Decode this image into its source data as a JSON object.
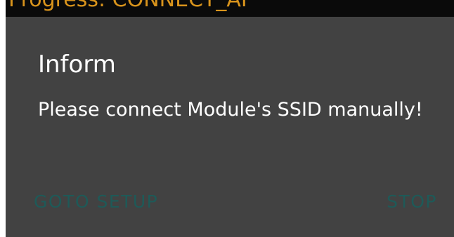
{
  "background": {
    "progress_text": "Progress: CONNECT_AP"
  },
  "dialog": {
    "title": "Inform",
    "message": "Please connect Module's SSID manually!",
    "negative_button": "GOTO SETUP",
    "positive_button": "STOP"
  },
  "colors": {
    "dialog_background": "#424242",
    "button_text": "#1e5a58",
    "progress_text": "#d9941c",
    "backdrop": "#0a0a0a"
  }
}
